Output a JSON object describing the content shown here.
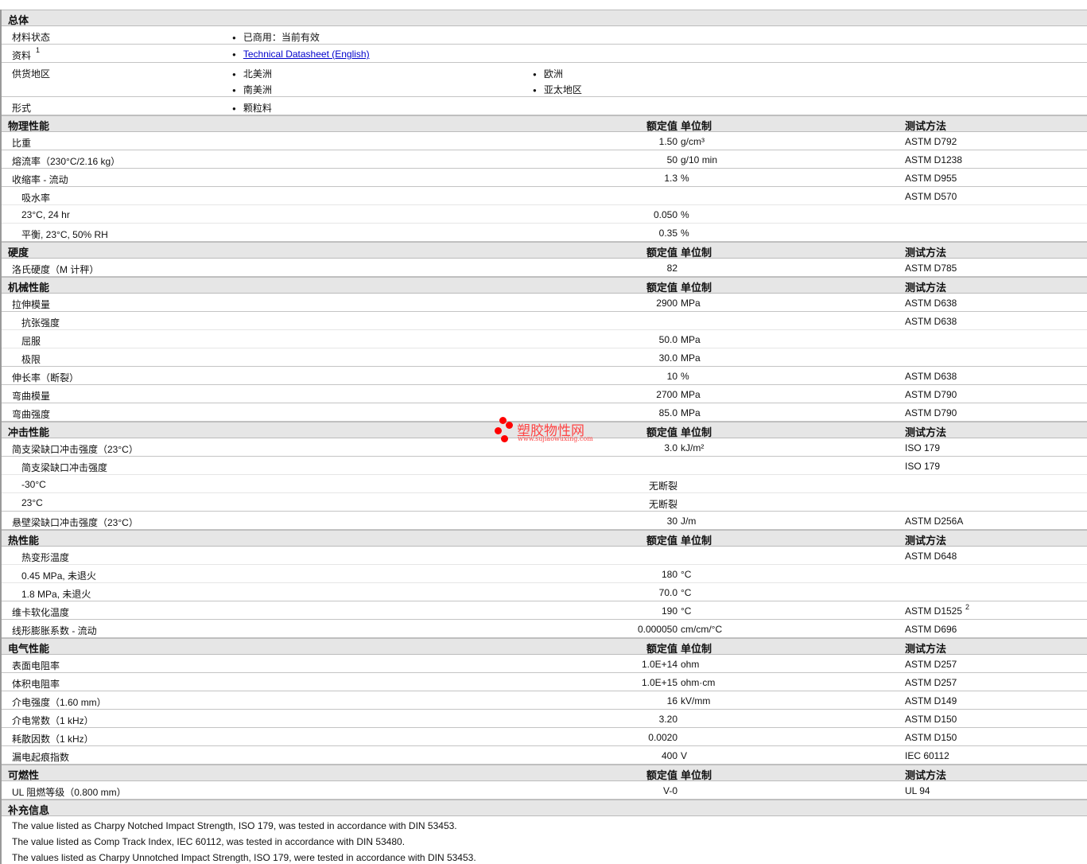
{
  "general": {
    "title": "总体",
    "rows": [
      {
        "label": "材料状态",
        "values": [
          "已商用：当前有效"
        ]
      },
      {
        "label": "资料",
        "sup": "1",
        "link": "Technical Datasheet (English)"
      },
      {
        "label": "供货地区",
        "values": [
          "北美洲",
          "南美洲"
        ],
        "values2": [
          "欧洲",
          "亚太地区"
        ]
      },
      {
        "label": "形式",
        "values": [
          "颗粒料"
        ]
      }
    ]
  },
  "col_headers": {
    "value": "额定值",
    "unit": "单位制",
    "method": "测试方法"
  },
  "sections": [
    {
      "title": "物理性能",
      "rows": [
        {
          "label": "比重",
          "value": "1.50",
          "unit": "g/cm³",
          "method": "ASTM D792"
        },
        {
          "label": "熔流率（230°C/2.16 kg）",
          "value": "50",
          "unit": "g/10 min",
          "method": "ASTM D1238"
        },
        {
          "label": "收缩率 - 流动",
          "value": "1.3",
          "unit": "%",
          "method": "ASTM D955"
        },
        {
          "label": "吸水率",
          "method": "ASTM D570",
          "parent": true
        },
        {
          "label": "23°C, 24 hr",
          "sub": true,
          "value": "0.050",
          "unit": "%"
        },
        {
          "label": "平衡, 23°C, 50% RH",
          "sub": true,
          "value": "0.35",
          "unit": "%"
        }
      ]
    },
    {
      "title": "硬度",
      "rows": [
        {
          "label": "洛氏硬度（M 计秤）",
          "value": "82",
          "method": "ASTM D785"
        }
      ]
    },
    {
      "title": "机械性能",
      "rows": [
        {
          "label": "拉伸模量",
          "value": "2900",
          "unit": "MPa",
          "method": "ASTM D638"
        },
        {
          "label": "抗张强度",
          "method": "ASTM D638",
          "parent": true
        },
        {
          "label": "屈服",
          "sub": true,
          "value": "50.0",
          "unit": "MPa"
        },
        {
          "label": "极限",
          "sub": true,
          "value": "30.0",
          "unit": "MPa"
        },
        {
          "label": "伸长率（断裂）",
          "value": "10",
          "unit": "%",
          "method": "ASTM D638"
        },
        {
          "label": "弯曲模量",
          "value": "2700",
          "unit": "MPa",
          "method": "ASTM D790"
        },
        {
          "label": "弯曲强度",
          "value": "85.0",
          "unit": "MPa",
          "method": "ASTM D790"
        }
      ]
    },
    {
      "title": "冲击性能",
      "rows": [
        {
          "label": "简支梁缺口冲击强度（23°C）",
          "value": "3.0",
          "unit": "kJ/m²",
          "method": "ISO 179"
        },
        {
          "label": "简支梁缺口冲击强度",
          "method": "ISO 179",
          "parent": true
        },
        {
          "label": "-30°C",
          "sub": true,
          "value": "无断裂"
        },
        {
          "label": "23°C",
          "sub": true,
          "value": "无断裂"
        },
        {
          "label": "悬壁梁缺口冲击强度（23°C）",
          "value": "30",
          "unit": "J/m",
          "method": "ASTM D256A"
        }
      ]
    },
    {
      "title": "热性能",
      "rows": [
        {
          "label": "热变形温度",
          "method": "ASTM D648",
          "parent": true
        },
        {
          "label": "0.45 MPa, 未退火",
          "sub": true,
          "value": "180",
          "unit": "°C"
        },
        {
          "label": "1.8 MPa, 未退火",
          "sub": true,
          "value": "70.0",
          "unit": "°C"
        },
        {
          "label": "维卡软化温度",
          "value": "190",
          "unit": "°C",
          "method": "ASTM D1525",
          "sup": "2"
        },
        {
          "label": "线形膨胀系数 - 流动",
          "value": "0.000050",
          "unit": "cm/cm/°C",
          "method": "ASTM D696"
        }
      ]
    },
    {
      "title": "电气性能",
      "rows": [
        {
          "label": "表面电阻率",
          "value": "1.0E+14",
          "unit": "ohm",
          "method": "ASTM D257"
        },
        {
          "label": "体积电阻率",
          "value": "1.0E+15",
          "unit": "ohm·cm",
          "method": "ASTM D257"
        },
        {
          "label": "介电强度（1.60 mm）",
          "value": "16",
          "unit": "kV/mm",
          "method": "ASTM D149"
        },
        {
          "label": "介电常数（1 kHz）",
          "value": "3.20",
          "method": "ASTM D150"
        },
        {
          "label": "耗散因数（1 kHz）",
          "value": "0.0020",
          "method": "ASTM D150"
        },
        {
          "label": "漏电起痕指数",
          "value": "400",
          "unit": "V",
          "method": "IEC 60112"
        }
      ]
    },
    {
      "title": "可燃性",
      "rows": [
        {
          "label": "UL 阻燃等级（0.800 mm）",
          "value": "V-0",
          "method": "UL 94"
        }
      ]
    }
  ],
  "notes": {
    "title": "补充信息",
    "lines": [
      "The value listed as Charpy Notched Impact Strength, ISO 179, was tested in accordance with DIN 53453.",
      "The value listed as Comp Track Index, IEC 60112, was tested in accordance with DIN 53480.",
      "The values listed as Charpy Unnotched Impact Strength, ISO 179, were tested in accordance with DIN 53453."
    ]
  },
  "watermark": {
    "title": "塑胶物性网",
    "url": "www.sujiaowuxing.com"
  }
}
